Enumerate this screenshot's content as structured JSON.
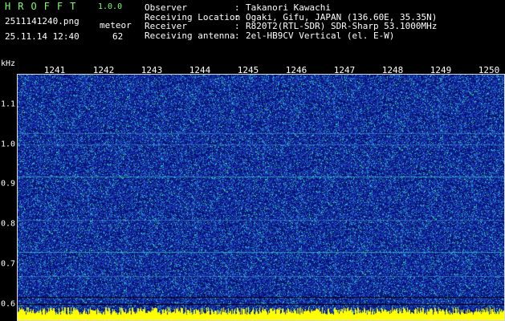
{
  "app": {
    "title": "HROFFT",
    "version": "1.0.0",
    "filename": "2511141240.png",
    "datetime": "25.11.14 12:40",
    "detect_label": "meteor",
    "detect_count": "62"
  },
  "info": [
    {
      "label": "Observer",
      "sep": ":",
      "value": "Takanori Kawachi"
    },
    {
      "label": "Receiving Location",
      "sep": ":",
      "value": "Ogaki, Gifu, JAPAN (136.60E, 35.35N)"
    },
    {
      "label": "Receiver",
      "sep": ":",
      "value": "R820T2(RTL-SDR) SDR-Sharp 53.1000MHz"
    },
    {
      "label": "Receiving antenna",
      "sep": ":",
      "value": "2el-HB9CV Vertical (el. E-W)"
    }
  ],
  "axis": {
    "unit": "kHz",
    "x_ticks": [
      "1241",
      "1242",
      "1243",
      "1244",
      "1245",
      "1246",
      "1247",
      "1248",
      "1249",
      "1250"
    ],
    "y_ticks": [
      "1.1",
      "1.0",
      "0.9",
      "0.8",
      "0.7",
      "0.6"
    ]
  },
  "colors": {
    "background": "#000000",
    "waterfall_base": "#1a2aa0",
    "signal_cyan": "#35e0d0",
    "signal_red": "#ff4040",
    "noise_yellow": "#ffff00",
    "header_green": "#7cff6a"
  }
}
